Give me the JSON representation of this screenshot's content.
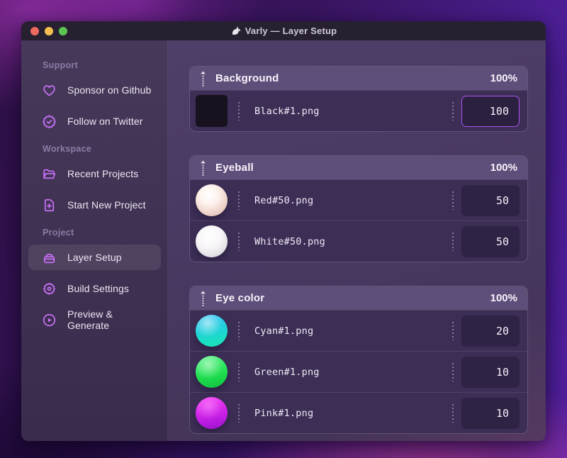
{
  "window": {
    "title": "Varly — Layer Setup",
    "traffic_lights": [
      "close",
      "minimize",
      "zoom"
    ]
  },
  "sidebar": {
    "sections": [
      {
        "label": "Support",
        "items": [
          {
            "label": "Sponsor on Github",
            "icon": "heart-icon",
            "active": false
          },
          {
            "label": "Follow on Twitter",
            "icon": "badge-check-icon",
            "active": false
          }
        ]
      },
      {
        "label": "Workspace",
        "items": [
          {
            "label": "Recent Projects",
            "icon": "folder-icon",
            "active": false
          },
          {
            "label": "Start New Project",
            "icon": "file-plus-icon",
            "active": false
          }
        ]
      },
      {
        "label": "Project",
        "items": [
          {
            "label": "Layer Setup",
            "icon": "layers-icon",
            "active": true
          },
          {
            "label": "Build Settings",
            "icon": "gear-icon",
            "active": false
          },
          {
            "label": "Preview & Generate",
            "icon": "play-circle-icon",
            "active": false
          }
        ]
      }
    ]
  },
  "layers": [
    {
      "name": "Background",
      "weight": "100%",
      "items": [
        {
          "file": "Black#1.png",
          "value": "100",
          "thumb": "black",
          "focused": true
        }
      ]
    },
    {
      "name": "Eyeball",
      "weight": "100%",
      "items": [
        {
          "file": "Red#50.png",
          "value": "50",
          "thumb": "red",
          "focused": false
        },
        {
          "file": "White#50.png",
          "value": "50",
          "thumb": "white",
          "focused": false
        }
      ]
    },
    {
      "name": "Eye color",
      "weight": "100%",
      "items": [
        {
          "file": "Cyan#1.png",
          "value": "20",
          "thumb": "cyan",
          "focused": false
        },
        {
          "file": "Green#1.png",
          "value": "10",
          "thumb": "green",
          "focused": false
        },
        {
          "file": "Pink#1.png",
          "value": "10",
          "thumb": "pink",
          "focused": false
        }
      ]
    }
  ],
  "colors": {
    "accent": "#c46ff4",
    "focus_border": "#ab54f0",
    "traffic_red": "#ee6a5f",
    "traffic_yellow": "#f5bf4f",
    "traffic_green": "#5dc454"
  }
}
